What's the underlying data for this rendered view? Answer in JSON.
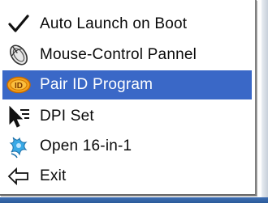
{
  "menu": {
    "items": [
      {
        "label": "Auto Launch on Boot",
        "icon": "checkmark-icon",
        "checked": true
      },
      {
        "label": "Mouse-Control Pannel",
        "icon": "mouse-control-icon"
      },
      {
        "label": "Pair ID Program",
        "icon": "pair-id-icon",
        "selected": true
      },
      {
        "label": "DPI Set",
        "icon": "dpi-cursor-icon"
      },
      {
        "label": "Open 16-in-1",
        "icon": "open-16in1-icon"
      },
      {
        "label": "Exit",
        "icon": "exit-arrow-icon"
      }
    ]
  },
  "colors": {
    "highlight": "#3a68c7",
    "highlight_text": "#ffffff",
    "menu_bg": "#ffffff",
    "text": "#0a0a0a"
  }
}
